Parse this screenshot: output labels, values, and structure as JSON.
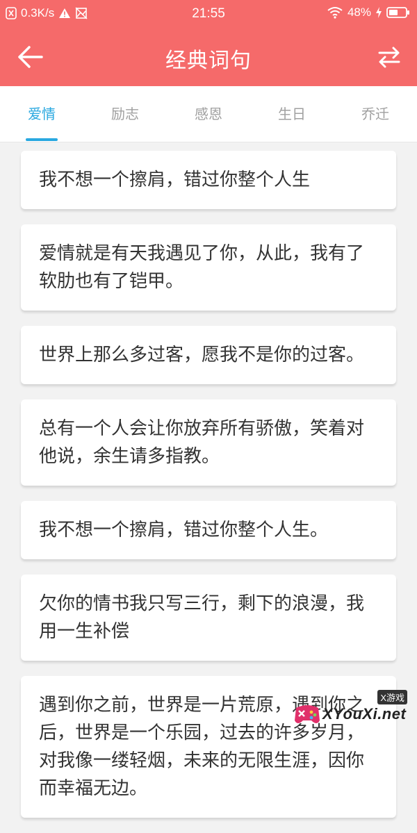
{
  "status_bar": {
    "speed": "0.3K/s",
    "time": "21:55",
    "battery": "48%"
  },
  "header": {
    "title": "经典词句"
  },
  "tabs": [
    {
      "label": "爱情",
      "active": true
    },
    {
      "label": "励志",
      "active": false
    },
    {
      "label": "感恩",
      "active": false
    },
    {
      "label": "生日",
      "active": false
    },
    {
      "label": "乔迁",
      "active": false
    }
  ],
  "quotes": [
    "我不想一个擦肩，错过你整个人生",
    "爱情就是有天我遇见了你，从此，我有了软肋也有了铠甲。",
    "世界上那么多过客，愿我不是你的过客。",
    "总有一个人会让你放弃所有骄傲，笑着对他说，余生请多指教。",
    "我不想一个擦肩，错过你整个人生。",
    "欠你的情书我只写三行，剩下的浪漫，我用一生补偿",
    "遇到你之前，世界是一片荒原，遇到你之后，世界是一个乐园，过去的许多岁月，对我像一缕轻烟，未来的无限生涯，因你而幸福无边。"
  ],
  "watermark": {
    "tag": "X游戏",
    "site": "XYouXi.net"
  },
  "colors": {
    "header": "#f56a6a",
    "tab_active": "#29a8e0",
    "background": "#f2f2f2"
  }
}
